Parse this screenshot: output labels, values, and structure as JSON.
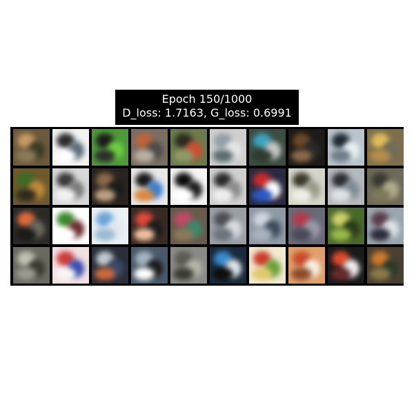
{
  "title": {
    "line1": "Epoch 150/1000",
    "line2": "D_loss: 1.7163, G_loss: 0.6991"
  },
  "grid": {
    "rows": 4,
    "cols": 10,
    "tiles": [
      {
        "bg": "#6b5a3c",
        "blobs": [
          "#c79a64",
          "#3b3a24",
          "#8c7b5a"
        ]
      },
      {
        "bg": "#f2f2f2",
        "blobs": [
          "#2b2b2b",
          "#5a6c78",
          "#ffffff"
        ]
      },
      {
        "bg": "#4e9a3a",
        "blobs": [
          "#1b1b1b",
          "#6fcf3f",
          "#2d2d2d"
        ]
      },
      {
        "bg": "#7a6e63",
        "blobs": [
          "#c0633a",
          "#4a4a4a",
          "#b9b1a3"
        ]
      },
      {
        "bg": "#6b7b4a",
        "blobs": [
          "#2d2a20",
          "#d14b32",
          "#8f9b67"
        ]
      },
      {
        "bg": "#cfcfcf",
        "blobs": [
          "#8f9ea6",
          "#e6e6e6",
          "#5b6b70"
        ]
      },
      {
        "bg": "#3c4d42",
        "blobs": [
          "#3aa6c4",
          "#c9c9c9",
          "#2d3a30"
        ]
      },
      {
        "bg": "#1e1a16",
        "blobs": [
          "#6b4a2c",
          "#2a2a2a",
          "#8a6a4a"
        ]
      },
      {
        "bg": "#b9c4cc",
        "blobs": [
          "#1f2a33",
          "#eaf0f2",
          "#6b7d89"
        ]
      },
      {
        "bg": "#7e6f4c",
        "blobs": [
          "#e0bf5a",
          "#6d6d5a",
          "#b58f4a"
        ]
      },
      {
        "bg": "#6c5a2c",
        "blobs": [
          "#3e6b24",
          "#c48a3a",
          "#2d2a1f"
        ]
      },
      {
        "bg": "#d8d8d8",
        "blobs": [
          "#3a3a3a",
          "#7a7a7a",
          "#f2f2f2"
        ]
      },
      {
        "bg": "#2a2420",
        "blobs": [
          "#8a6a4a",
          "#1b1b1b",
          "#c0a080"
        ]
      },
      {
        "bg": "#e8e8e8",
        "blobs": [
          "#1a1a1a",
          "#3c7ecf",
          "#d8873a"
        ]
      },
      {
        "bg": "#f4f4f4",
        "blobs": [
          "#0d0d0d",
          "#1c1c1c",
          "#ffffff"
        ]
      },
      {
        "bg": "#d0d0d0",
        "blobs": [
          "#2a2a2a",
          "#8a8a8a",
          "#efefef"
        ]
      },
      {
        "bg": "#2b2a40",
        "blobs": [
          "#cf2b2b",
          "#ffffff",
          "#2d5ac9"
        ]
      },
      {
        "bg": "#d6d4c8",
        "blobs": [
          "#3a3a2a",
          "#9a9a88",
          "#f0eee6"
        ]
      },
      {
        "bg": "#b4b9bd",
        "blobs": [
          "#2a2e31",
          "#7e8a93",
          "#dde1e4"
        ]
      },
      {
        "bg": "#6e6a5a",
        "blobs": [
          "#3a3a2f",
          "#b4aa8a",
          "#7d7a5a"
        ]
      },
      {
        "bg": "#2b2a28",
        "blobs": [
          "#e06a3a",
          "#6a6a60",
          "#1a1a1a"
        ]
      },
      {
        "bg": "#ffffff",
        "blobs": [
          "#3c8a2c",
          "#6a2b2b",
          "#ffffff"
        ]
      },
      {
        "bg": "#eaf0f4",
        "blobs": [
          "#6aa5d8",
          "#dfe9f0",
          "#9ab8d0"
        ]
      },
      {
        "bg": "#3a2a24",
        "blobs": [
          "#e04a3a",
          "#1b1b1b",
          "#f0c0a0"
        ]
      },
      {
        "bg": "#6a5a4a",
        "blobs": [
          "#c24a6a",
          "#3a8a6a",
          "#8a7a5a"
        ]
      },
      {
        "bg": "#9aa0a6",
        "blobs": [
          "#4a4e52",
          "#d9dde1",
          "#6b7378"
        ]
      },
      {
        "bg": "#8e9aa6",
        "blobs": [
          "#cfd6de",
          "#3a4a5a",
          "#a8b3bd"
        ]
      },
      {
        "bg": "#6a6a78",
        "blobs": [
          "#b43a4a",
          "#9a9aa8",
          "#4a4a58"
        ]
      },
      {
        "bg": "#4a6a2a",
        "blobs": [
          "#d0d06a",
          "#2a3a1a",
          "#9ab84a"
        ]
      },
      {
        "bg": "#9aa6ae",
        "blobs": [
          "#5a3a4a",
          "#dfe4e8",
          "#2a2a3a"
        ]
      },
      {
        "bg": "#6a6a60",
        "blobs": [
          "#c0c0b4",
          "#3a3a30",
          "#9a9a90"
        ]
      },
      {
        "bg": "#f0e0e0",
        "blobs": [
          "#d03a3a",
          "#3a4ab0",
          "#f6f6f6"
        ]
      },
      {
        "bg": "#2a2e3a",
        "blobs": [
          "#c0c8d0",
          "#3a4a6a",
          "#d06a3a"
        ]
      },
      {
        "bg": "#4a5a6a",
        "blobs": [
          "#a6b4c0",
          "#1a1a1a",
          "#ffffff"
        ]
      },
      {
        "bg": "#8a8a86",
        "blobs": [
          "#5a5a52",
          "#b4b4a8",
          "#3a3a32"
        ]
      },
      {
        "bg": "#1a2a3a",
        "blobs": [
          "#3a8ad0",
          "#e0e6ea",
          "#0d0d0d"
        ]
      },
      {
        "bg": "#f0ead0",
        "blobs": [
          "#d03a2a",
          "#6aa03a",
          "#e0c86a"
        ]
      },
      {
        "bg": "#e0a06a",
        "blobs": [
          "#c84a2a",
          "#f6f0e6",
          "#8a4a2a"
        ]
      },
      {
        "bg": "#1a1a1a",
        "blobs": [
          "#e04a2a",
          "#f0f0f0",
          "#6a2a2a"
        ]
      },
      {
        "bg": "#4a4030",
        "blobs": [
          "#d07a2a",
          "#2a3a2a",
          "#8a7a4a"
        ]
      }
    ]
  }
}
